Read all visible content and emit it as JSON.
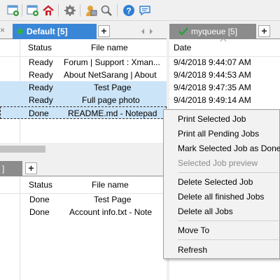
{
  "toolbar": {
    "icons": [
      "add-queue-icon",
      "add-window-icon",
      "home-icon",
      "gear-icon",
      "printer-user-icon",
      "search-icon",
      "help-icon",
      "chat-icon"
    ]
  },
  "top_left": {
    "tab_label": "Default [5]",
    "columns": [
      "Status",
      "File name"
    ],
    "rows": [
      {
        "status": "Ready",
        "file": "Forum | Support : Xman..."
      },
      {
        "status": "Ready",
        "file": "About NetSarang | About"
      },
      {
        "status": "Ready",
        "file": "Test Page"
      },
      {
        "status": "Ready",
        "file": "Full page photo"
      },
      {
        "status": "Done",
        "file": "README.md - Notepad"
      }
    ]
  },
  "top_right": {
    "tab_label": "myqueue [5]",
    "columns": [
      "Date"
    ],
    "rows": [
      "9/4/2018 9:44:07 AM",
      "9/4/2018 9:44:53 AM",
      "9/4/2018 9:47:35 AM",
      "9/4/2018 9:49:14 AM"
    ]
  },
  "bottom_left": {
    "tab_label": "]",
    "columns": [
      "Status",
      "File name"
    ],
    "rows": [
      {
        "status": "Done",
        "file": "Test Page"
      },
      {
        "status": "Done",
        "file": "Account info.txt - Note"
      }
    ]
  },
  "context_menu": {
    "items": [
      {
        "label": "Print Selected Job",
        "disabled": false
      },
      {
        "label": "Print all Pending Jobs",
        "disabled": false
      },
      {
        "label": "Mark Selected Job as Done",
        "disabled": false
      },
      {
        "label": "Selected Job preview",
        "disabled": true
      },
      {
        "label": "Delete Selected Job",
        "disabled": false
      },
      {
        "label": "Delete all finished Jobs",
        "disabled": false
      },
      {
        "label": "Delete all Jobs",
        "disabled": false
      },
      {
        "label": "Move To",
        "disabled": false
      },
      {
        "label": "Refresh",
        "disabled": false
      }
    ]
  },
  "colors": {
    "accent": "#3a86d6",
    "selection": "#cce4f7",
    "inactive_tab": "#8c8c8c",
    "check": "#2e9e3e"
  }
}
